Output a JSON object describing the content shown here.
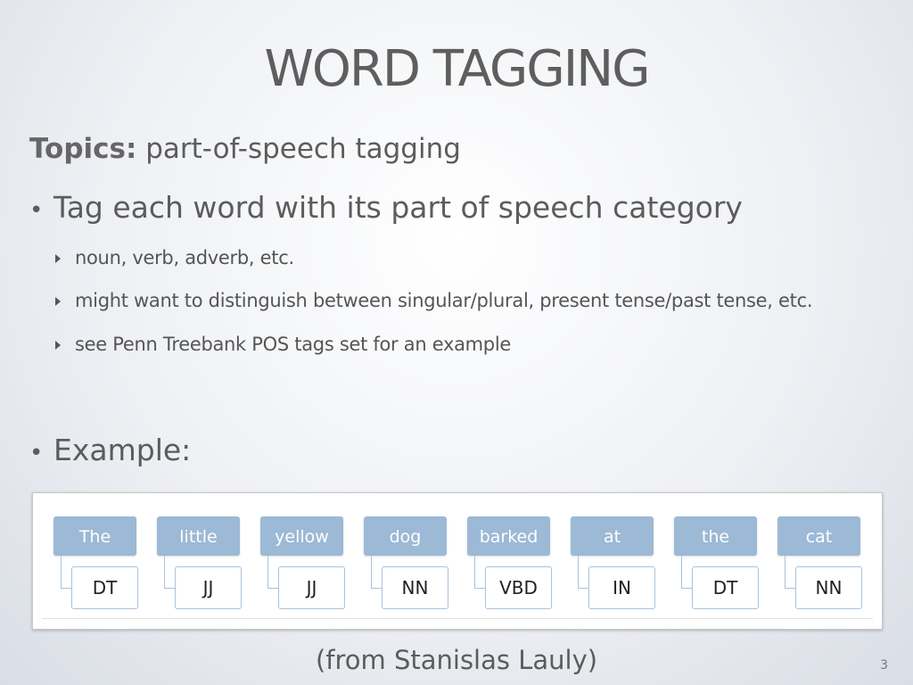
{
  "slide": {
    "title": "WORD TAGGING",
    "topics_label": "Topics:",
    "topics_text": "part-of-speech tagging",
    "bullets": [
      {
        "text": "Tag each word with its part of speech category"
      },
      {
        "text": "Example:"
      }
    ],
    "sub_bullets": [
      "noun, verb, adverb, etc.",
      "might want to distinguish between singular/plural, present tense/past tense, etc.",
      "see Penn Treebank POS tags set for an example"
    ],
    "tagging_example": [
      {
        "word": "The",
        "tag": "DT"
      },
      {
        "word": "little",
        "tag": "JJ"
      },
      {
        "word": "yellow",
        "tag": "JJ"
      },
      {
        "word": "dog",
        "tag": "NN"
      },
      {
        "word": "barked",
        "tag": "VBD"
      },
      {
        "word": "at",
        "tag": "IN"
      },
      {
        "word": "the",
        "tag": "DT"
      },
      {
        "word": "cat",
        "tag": "NN"
      }
    ],
    "source": "(from Stanislas Lauly)",
    "page_number": "3",
    "colors": {
      "word_box": "#9cb9d6",
      "tag_border": "#a9c3dd",
      "text": "#5c5c5c"
    }
  }
}
